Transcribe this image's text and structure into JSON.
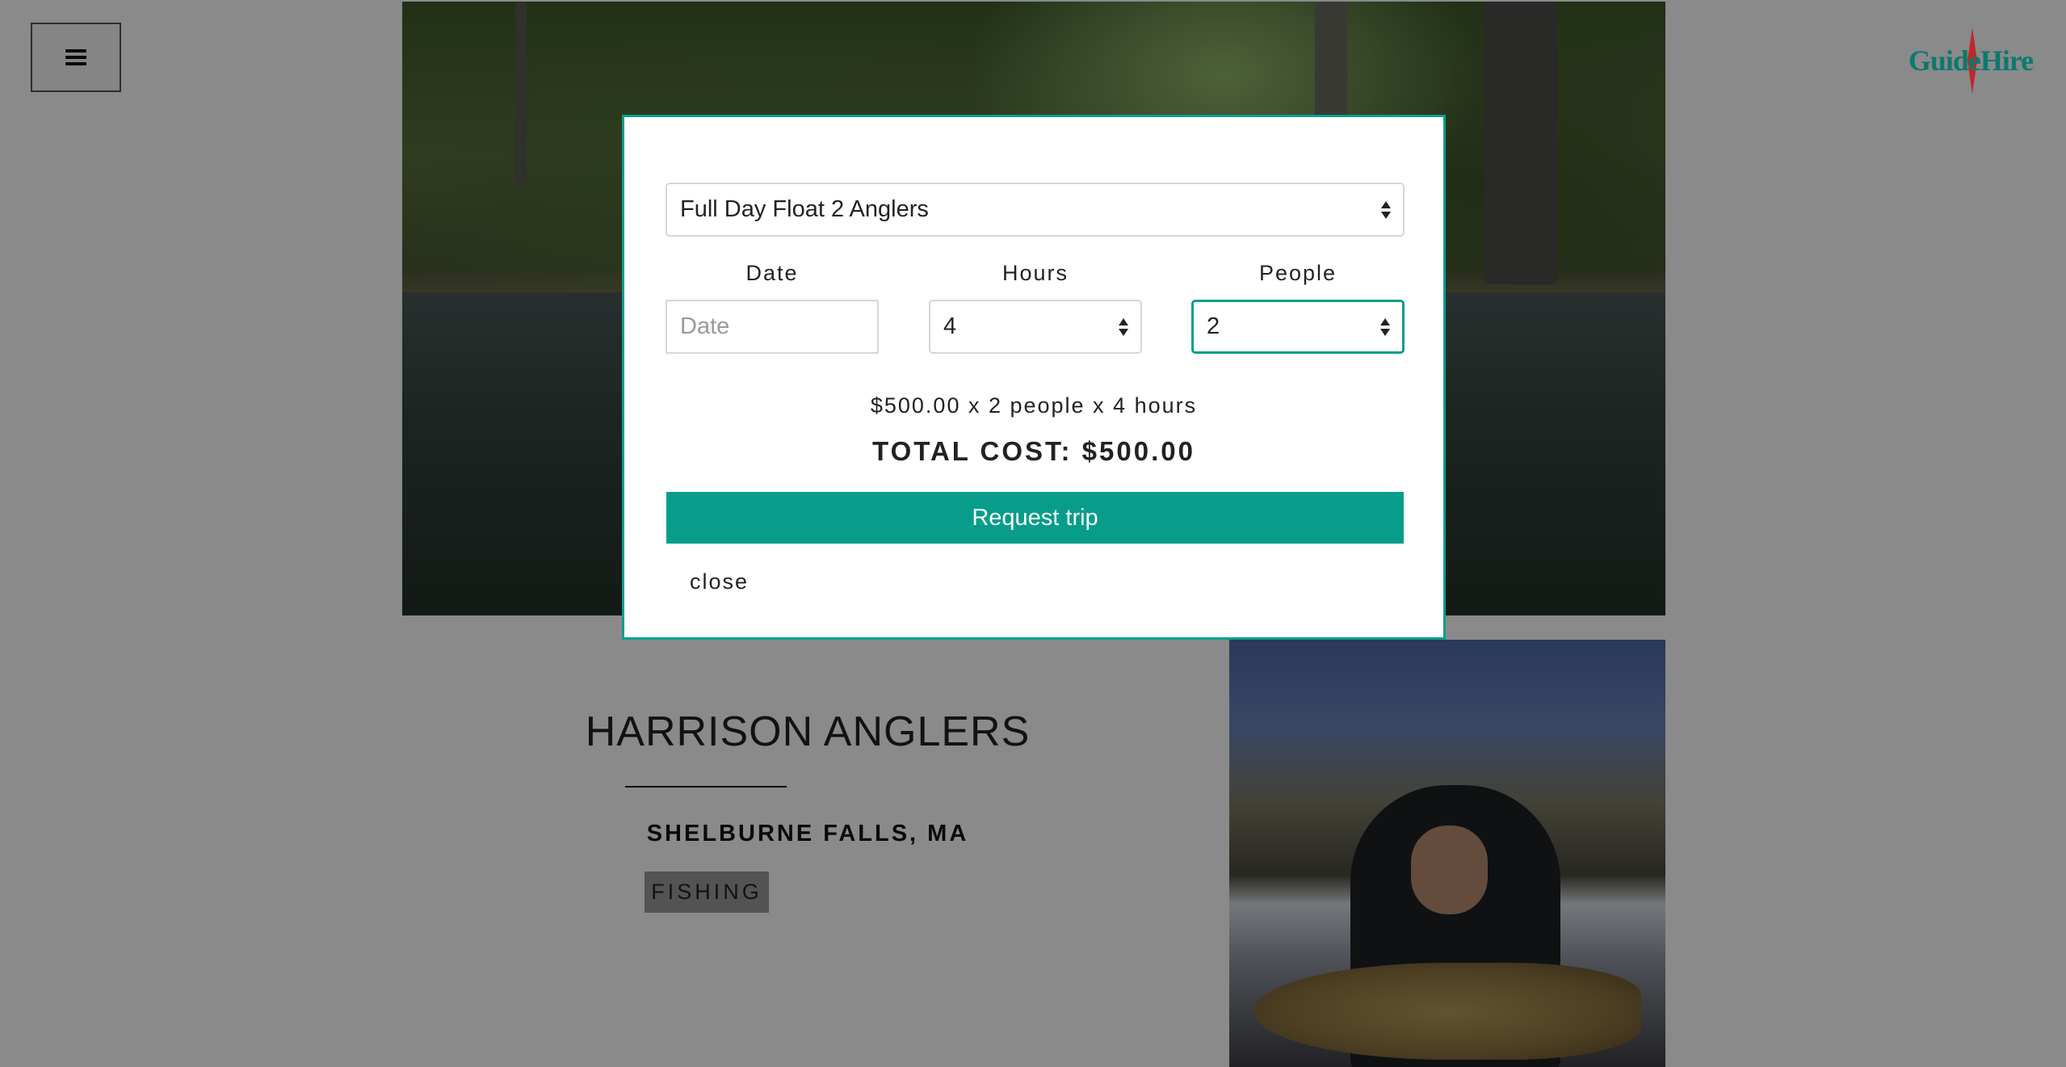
{
  "header": {
    "menu_icon": "hamburger-menu-icon",
    "logo": {
      "text": "GuideHire",
      "brand_color": "#0a7a6e",
      "needle_color": "#c2262b"
    }
  },
  "profile": {
    "name": "HARRISON ANGLERS",
    "location": "SHELBURNE FALLS, MA",
    "tag": "FISHING"
  },
  "modal": {
    "package_select": {
      "value": "Full Day Float 2 Anglers"
    },
    "date": {
      "label": "Date",
      "placeholder": "Date",
      "value": ""
    },
    "hours": {
      "label": "Hours",
      "value": "4"
    },
    "people": {
      "label": "People",
      "value": "2"
    },
    "breakdown": "$500.00 x 2 people x 4 hours",
    "total": "TOTAL COST: $500.00",
    "request_button": "Request trip",
    "close_link": "close",
    "accent_color": "#0a9e8e"
  }
}
